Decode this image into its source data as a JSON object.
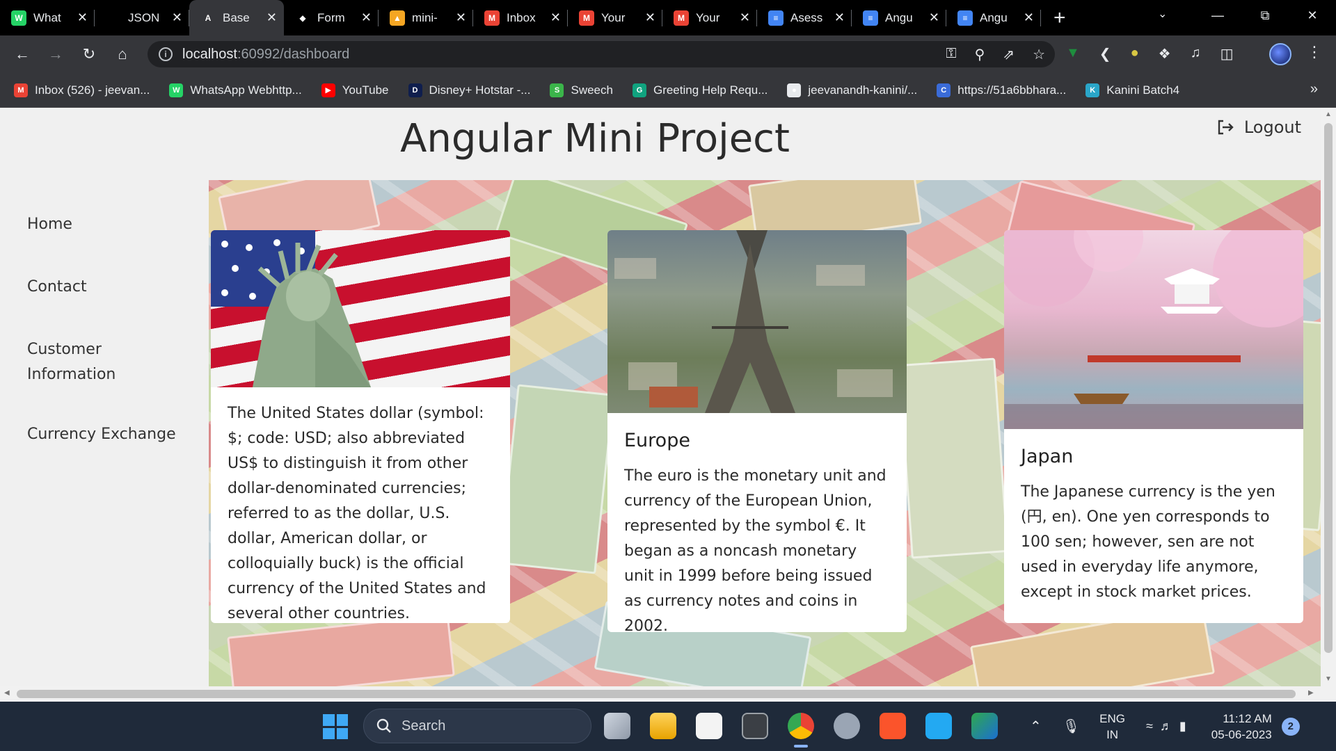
{
  "browser": {
    "tabs": [
      {
        "title": "What",
        "fav_color": "#25D366",
        "fav_glyph": "W"
      },
      {
        "title": "JSON",
        "fav_color": "#000000",
        "fav_glyph": ""
      },
      {
        "title": "Base",
        "fav_color": "#35363a",
        "fav_glyph": "A"
      },
      {
        "title": "Form",
        "fav_color": "#000000",
        "fav_glyph": "◆"
      },
      {
        "title": "mini-",
        "fav_color": "#f5a623",
        "fav_glyph": "▲"
      },
      {
        "title": "Inbox",
        "fav_color": "#EA4335",
        "fav_glyph": "M"
      },
      {
        "title": "Your",
        "fav_color": "#EA4335",
        "fav_glyph": "M"
      },
      {
        "title": "Your",
        "fav_color": "#EA4335",
        "fav_glyph": "M"
      },
      {
        "title": "Asess",
        "fav_color": "#4285F4",
        "fav_glyph": "≡"
      },
      {
        "title": "Angu",
        "fav_color": "#4285F4",
        "fav_glyph": "≡"
      },
      {
        "title": "Angu",
        "fav_color": "#4285F4",
        "fav_glyph": "≡"
      }
    ],
    "active_tab_index": 2,
    "url_host": "localhost",
    "url_path": ":60992/dashboard",
    "bookmarks": [
      {
        "label": "Inbox (526) - jeevan...",
        "color": "#EA4335",
        "glyph": "M"
      },
      {
        "label": "WhatsApp Webhttp...",
        "color": "#25D366",
        "glyph": "W"
      },
      {
        "label": "YouTube",
        "color": "#FF0000",
        "glyph": "▶"
      },
      {
        "label": "Disney+ Hotstar -...",
        "color": "#0f1e4d",
        "glyph": "D"
      },
      {
        "label": "Sweech",
        "color": "#3bb54a",
        "glyph": "S"
      },
      {
        "label": "Greeting Help Requ...",
        "color": "#10a37f",
        "glyph": "G"
      },
      {
        "label": "jeevanandh-kanini/...",
        "color": "#e8eaed",
        "glyph": "●"
      },
      {
        "label": "https://51a6bbhara...",
        "color": "#3a6bd8",
        "glyph": "C"
      },
      {
        "label": "Kanini Batch4",
        "color": "#2aa6c9",
        "glyph": "K"
      }
    ]
  },
  "app": {
    "title": "Angular Mini Project",
    "logout_label": "Logout",
    "nav": [
      {
        "label": "Home"
      },
      {
        "label": "Contact"
      },
      {
        "label": "Customer Information"
      },
      {
        "label": "Currency Exchange"
      }
    ],
    "cards": [
      {
        "title": "",
        "text": "The United States dollar (symbol: $; code: USD; also abbreviated US$ to distinguish it from other dollar-denominated currencies; referred to as the dollar, U.S. dollar, American dollar, or colloquially buck) is the official currency of the United States and several other countries."
      },
      {
        "title": "Europe",
        "text": "The euro is the monetary unit and currency of the European Union, represented by the symbol €. It began as a noncash monetary unit in 1999 before being issued as currency notes and coins in 2002."
      },
      {
        "title": "Japan",
        "text": "The Japanese currency is the yen (円, en). One yen corresponds to 100 sen; however, sen are not used in everyday life anymore, except in stock market prices."
      }
    ]
  },
  "taskbar": {
    "search_label": "Search",
    "lang_line1": "ENG",
    "lang_line2": "IN",
    "time": "11:12 AM",
    "date": "05-06-2023",
    "notification_count": "2"
  }
}
